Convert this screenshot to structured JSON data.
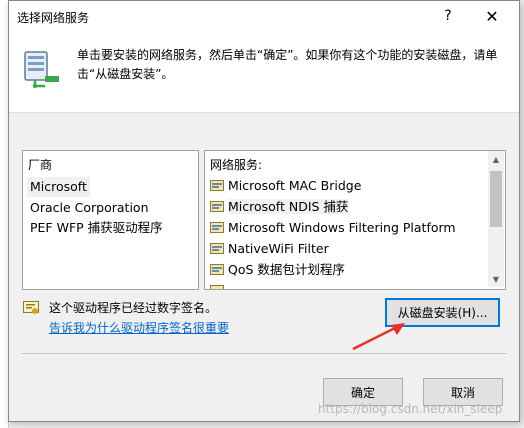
{
  "dialog": {
    "title": "选择网络服务",
    "help_glyph": "?",
    "close_glyph": "✕",
    "instruction": "单击要安装的网络服务，然后单击“确定”。如果你有这个功能的安装磁盘，请单击“从磁盘安装”。"
  },
  "manufacturers": {
    "header": "厂商",
    "items": [
      "Microsoft",
      "Oracle Corporation",
      "PEF WFP 捕获驱动程序"
    ],
    "selected": "Microsoft"
  },
  "services": {
    "header": "网络服务:",
    "items": [
      "Microsoft MAC Bridge",
      "Microsoft NDIS 捕获",
      "Microsoft Windows Filtering Platform",
      "NativeWiFi Filter",
      "QoS 数据包计划程序"
    ],
    "selected": "Microsoft NDIS 捕获"
  },
  "signature": {
    "text": "这个驱动程序已经过数字签名。",
    "link": "告诉我为什么驱动程序签名很重要"
  },
  "buttons": {
    "have_disk": "从磁盘安装(H)...",
    "ok": "确定",
    "cancel": "取消"
  },
  "watermark": "https://blog.csdn.net/xin_sleep",
  "colors": {
    "link": "#0066cc",
    "focus_border": "#0078d7",
    "annotation_arrow": "#e8302a"
  }
}
